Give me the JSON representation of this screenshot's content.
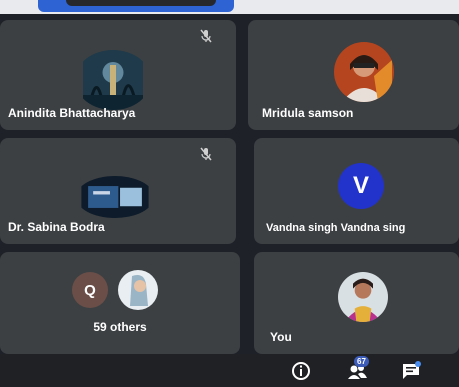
{
  "participants": [
    {
      "name": "Anindita Bhattacharya",
      "muted": true
    },
    {
      "name": "Mridula samson",
      "muted": false
    },
    {
      "name": "Dr. Sabina Bodra",
      "muted": true
    },
    {
      "name": "Vandna singh Vandna sing",
      "muted": false,
      "avatar_letter": "V",
      "avatar_color": "#2233cc"
    },
    {
      "name": "You",
      "muted": false
    }
  ],
  "others": {
    "avatar_letter": "Q",
    "label": "59 others"
  },
  "toolbar": {
    "people_count": "67",
    "icons": [
      "info-icon",
      "people-icon",
      "chat-icon"
    ]
  },
  "colors": {
    "tile": "#3c4043",
    "background": "#1e2127",
    "accent": "#2d63d2"
  }
}
